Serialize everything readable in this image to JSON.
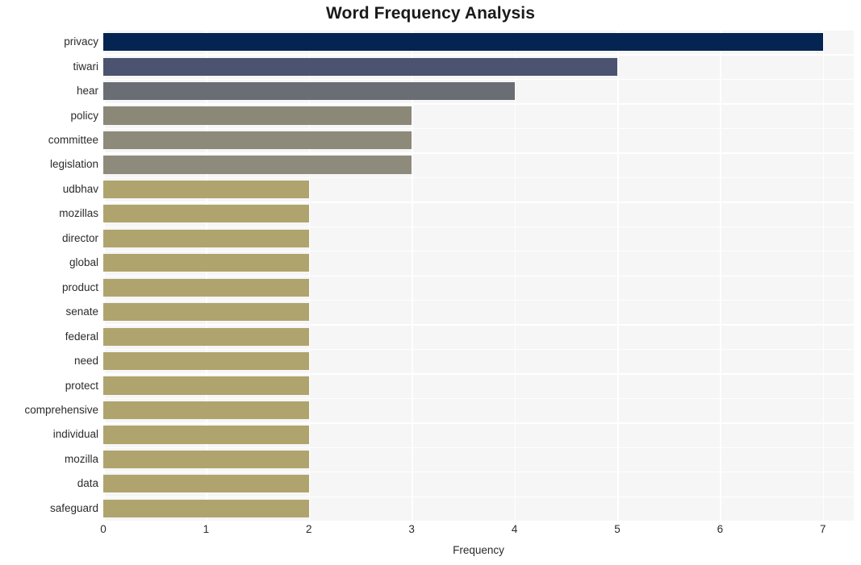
{
  "chart_data": {
    "type": "bar",
    "orientation": "horizontal",
    "title": "Word Frequency Analysis",
    "xlabel": "Frequency",
    "ylabel": "",
    "categories": [
      "privacy",
      "tiwari",
      "hear",
      "policy",
      "committee",
      "legislation",
      "udbhav",
      "mozillas",
      "director",
      "global",
      "product",
      "senate",
      "federal",
      "need",
      "protect",
      "comprehensive",
      "individual",
      "mozilla",
      "data",
      "safeguard"
    ],
    "values": [
      7,
      5,
      4,
      3,
      3,
      3,
      2,
      2,
      2,
      2,
      2,
      2,
      2,
      2,
      2,
      2,
      2,
      2,
      2,
      2
    ],
    "bar_colors": [
      "#052451",
      "#4b5370",
      "#6a6d74",
      "#8b8878",
      "#8d8a7a",
      "#8f8b7c",
      "#b0a46e",
      "#b0a46e",
      "#b0a46e",
      "#b0a46e",
      "#b0a46e",
      "#b0a46e",
      "#b0a46e",
      "#b0a46e",
      "#b0a46e",
      "#b0a46e",
      "#b0a46e",
      "#b0a46e",
      "#b0a46e",
      "#b0a46e"
    ],
    "xlim": [
      0,
      7.3
    ],
    "xticks": [
      0,
      1,
      2,
      3,
      4,
      5,
      6,
      7
    ],
    "xtick_labels": [
      "0",
      "1",
      "2",
      "3",
      "4",
      "5",
      "6",
      "7"
    ],
    "grid": true,
    "grid_color": "#ffffff",
    "plot_background": "#f6f6f6",
    "figure_background": "#ffffff",
    "legend": null
  }
}
